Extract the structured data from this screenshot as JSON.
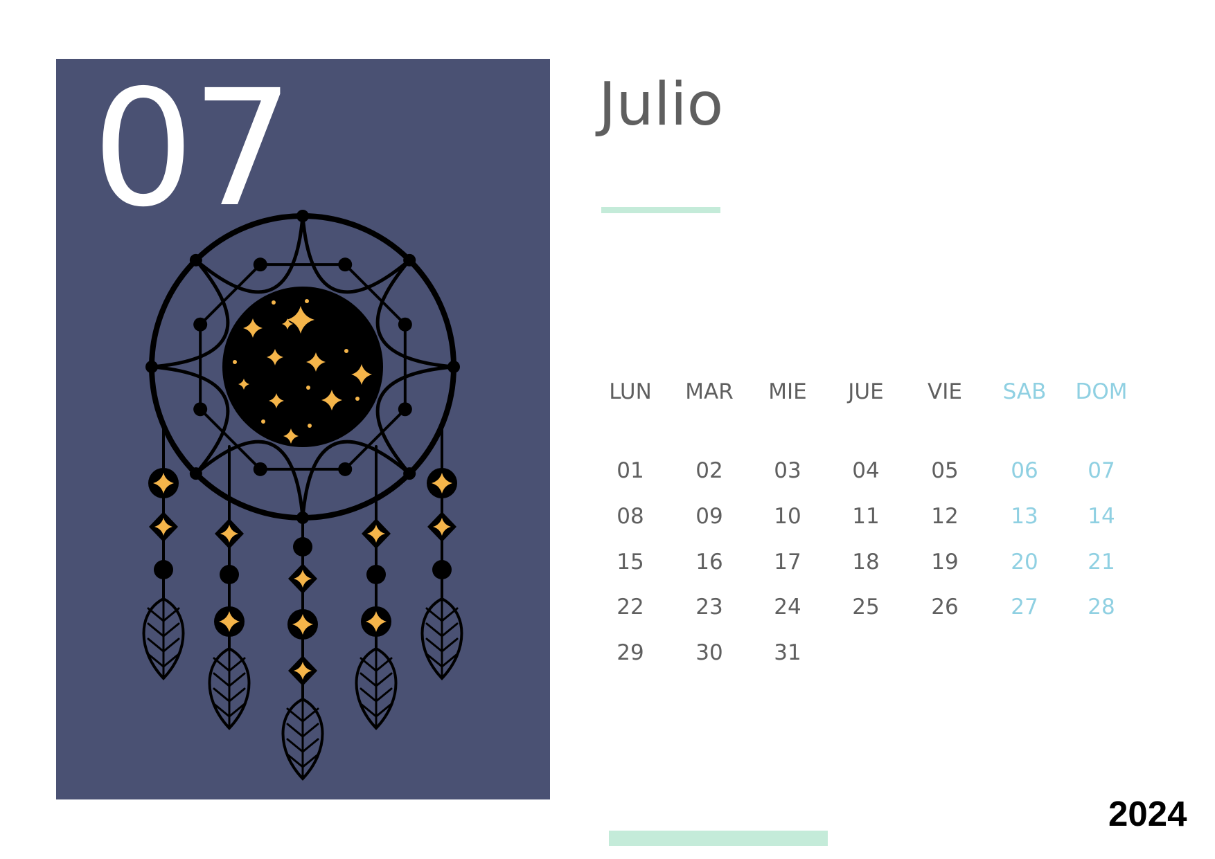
{
  "panel": {
    "month_number": "07",
    "background_color": "#4a5173",
    "illustration": "dreamcatcher-with-stars"
  },
  "header": {
    "month_name": "Julio"
  },
  "calendar": {
    "weekdays": [
      "LUN",
      "MAR",
      "MIE",
      "JUE",
      "VIE",
      "SAB",
      "DOM"
    ],
    "weeks": [
      [
        "01",
        "02",
        "03",
        "04",
        "05",
        "06",
        "07"
      ],
      [
        "08",
        "09",
        "10",
        "11",
        "12",
        "13",
        "14"
      ],
      [
        "15",
        "16",
        "17",
        "18",
        "19",
        "20",
        "21"
      ],
      [
        "22",
        "23",
        "24",
        "25",
        "26",
        "27",
        "28"
      ],
      [
        "29",
        "30",
        "31",
        "",
        "",
        "",
        ""
      ]
    ],
    "weekday_color": "#5f5f5f",
    "weekend_color": "#8fd0e2"
  },
  "footer": {
    "year": "2024"
  },
  "colors": {
    "accent_bar": "#c4ebd9",
    "star": "#f5b54a"
  }
}
